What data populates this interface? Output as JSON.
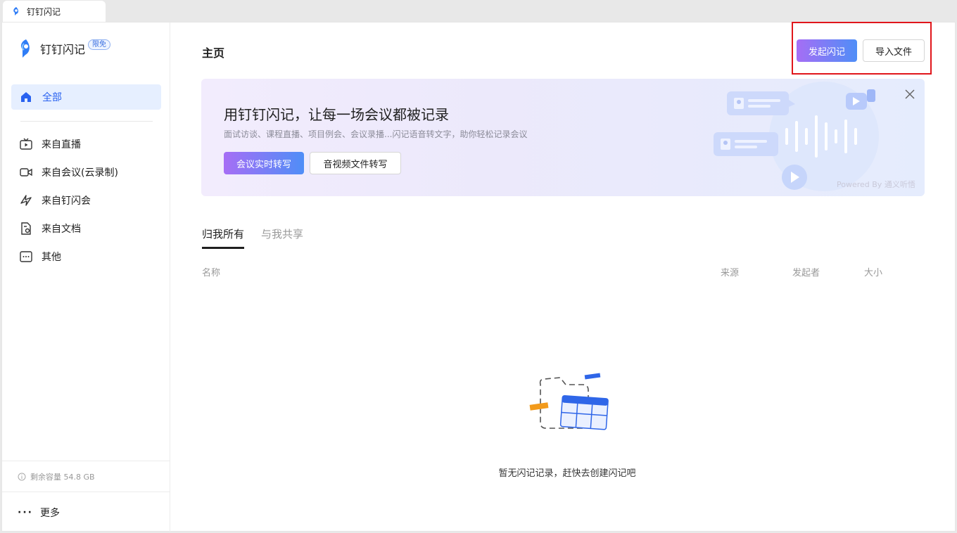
{
  "window_tab": {
    "title": "钉钉闪记"
  },
  "sidebar": {
    "brand_name": "钉钉闪记",
    "brand_badge": "限免",
    "active_item": "全部",
    "items": [
      {
        "label": "来自直播",
        "icon": "live-tv-icon"
      },
      {
        "label": "来自会议(云录制)",
        "icon": "video-camera-icon"
      },
      {
        "label": "来自钉闪会",
        "icon": "flash-meeting-icon"
      },
      {
        "label": "来自文档",
        "icon": "document-icon"
      },
      {
        "label": "其他",
        "icon": "more-box-icon"
      }
    ],
    "storage": "剩余容量 54.8 GB",
    "more": "更多"
  },
  "header": {
    "title": "主页",
    "primary_button": "发起闪记",
    "secondary_button": "导入文件"
  },
  "banner": {
    "title": "用钉钉闪记，让每一场会议都被记录",
    "subtitle": "面试访谈、课程直播、项目例会、会议录播...闪记语音转文字，助你轻松记录会议",
    "button1": "会议实时转写",
    "button2": "音视频文件转写",
    "powered_by": "Powered By 通义听悟"
  },
  "tabs": [
    {
      "label": "归我所有",
      "active": true
    },
    {
      "label": "与我共享",
      "active": false
    }
  ],
  "table_headers": {
    "name": "名称",
    "source": "来源",
    "initiator": "发起者",
    "size": "大小"
  },
  "empty_state": "暂无闪记记录，赶快去创建闪记吧",
  "colors": {
    "accent": "#2962f0",
    "highlight_border": "#e0161b",
    "gradient_start": "#a66ef5",
    "gradient_end": "#4f8ef7"
  }
}
